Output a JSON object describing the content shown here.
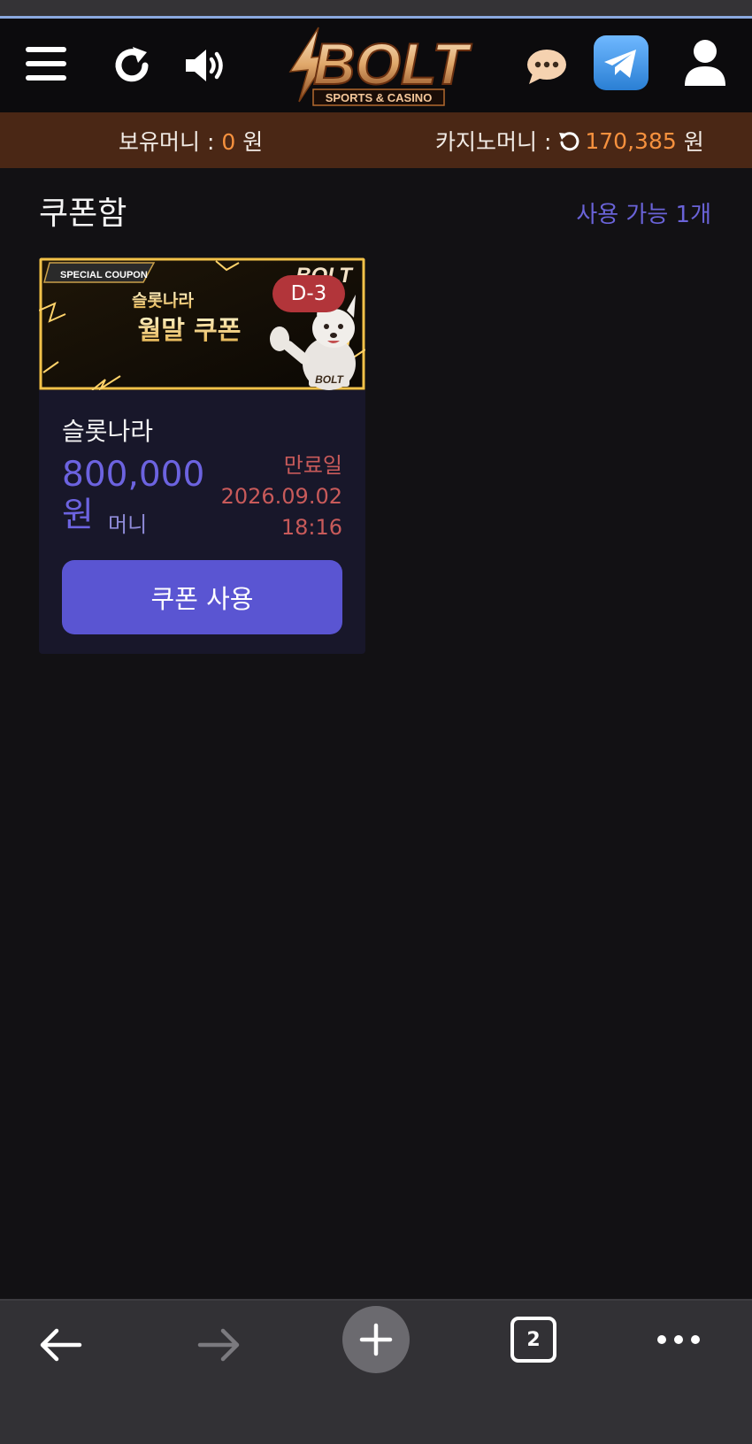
{
  "header": {
    "logo_main": "BOLT",
    "logo_sub": "SPORTS & CASINO",
    "icons": [
      "menu-icon",
      "refresh-icon",
      "volume-icon",
      "chat-icon",
      "telegram-icon",
      "user-icon"
    ]
  },
  "balance": {
    "holding_label": "보유머니 :",
    "holding_value": "0",
    "holding_unit": "원",
    "casino_label": "카지노머니 :",
    "casino_value": "170,385",
    "casino_unit": "원"
  },
  "page": {
    "title": "쿠폰함",
    "available": "사용 가능 1개"
  },
  "coupon": {
    "banner_tag": "SPECIAL COUPON",
    "banner_line1": "슬롯나라",
    "banner_line2": "월말 쿠폰",
    "banner_logo": "BOLT",
    "mascot_logo": "BOLT",
    "dday": "D-3",
    "name": "슬롯나라",
    "amount": "800,000",
    "amount_unit": "원",
    "money_label": "머니",
    "expire_label": "만료일",
    "expire_date": "2026.09.02",
    "expire_time": "18:16",
    "use_button": "쿠폰 사용"
  },
  "browser_nav": {
    "tab_count": "2",
    "icons": [
      "back-arrow-icon",
      "forward-arrow-icon",
      "new-tab-icon",
      "tabs-icon",
      "more-icon"
    ]
  },
  "colors": {
    "accent": "#5a55d2",
    "orange": "#f6913e",
    "brown_bar": "#4a2715",
    "dday": "#b2353a"
  }
}
